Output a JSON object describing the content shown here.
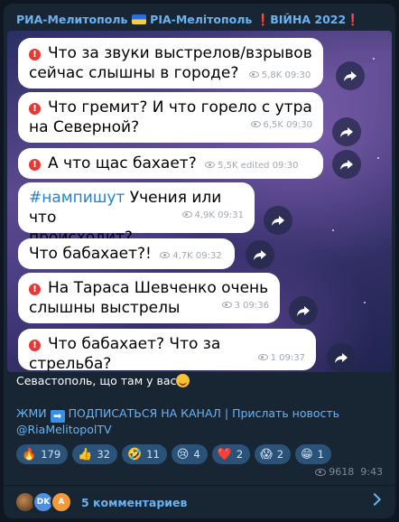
{
  "channel": {
    "name_part1": "РИА-Мелитополь",
    "name_part2": "РІА-Мелітополь",
    "war_label": "ВІЙНА 2022"
  },
  "messages": [
    {
      "line1": "Что за звуки выстрелов/взрывов",
      "line2": "сейчас слышны в городе?",
      "views": "5,8K",
      "time": "09:30",
      "alert": true
    },
    {
      "line1": "Что гремит? И что горело с утра",
      "line2": "на Северной?",
      "views": "6,5K",
      "time": "09:30",
      "alert": true
    },
    {
      "line1": "А что щас бахает?",
      "line2": "",
      "views": "5,5K",
      "edited": "edited",
      "time": "09:30",
      "alert": true
    },
    {
      "hashtag": "#нампишут",
      "line1": "Учения или что",
      "line2": "происходит?",
      "views": "4,9K",
      "time": "09:31",
      "alert": false
    },
    {
      "line1": "Что бабахает?!",
      "line2": "",
      "views": "4,7K",
      "time": "09:32",
      "alert": false
    },
    {
      "line1": "На Тараса Шевченко очень",
      "line2": "слышны выстрелы",
      "views": "3",
      "time": "09:36",
      "alert": true
    },
    {
      "line1": "Что бабахает? Что за стрельба?",
      "line2": "",
      "views": "1",
      "time": "09:37",
      "alert": true
    }
  ],
  "caption": {
    "text": "Севастополь, що там у вас",
    "cta_prefix": "ЖМИ",
    "cta_text": "ПОДПИСАТЬСЯ НА КАНАЛ | Прислать новость",
    "handle": "@RiaMelitopolTV"
  },
  "reactions": [
    {
      "emoji": "🔥",
      "count": "179"
    },
    {
      "emoji": "👍",
      "count": "32"
    },
    {
      "emoji": "🤣",
      "count": "11"
    },
    {
      "emoji": "😢",
      "count": "4"
    },
    {
      "emoji": "❤️",
      "count": "2"
    },
    {
      "emoji": "😱",
      "count": "2"
    },
    {
      "emoji": "😁",
      "count": "1"
    }
  ],
  "post": {
    "views": "9618",
    "time": "9:43"
  },
  "comments": {
    "label": "5 комментариев",
    "avatars": [
      {
        "initials": ""
      },
      {
        "initials": "DK"
      },
      {
        "initials": "A"
      }
    ]
  },
  "colors": {
    "accent": "#6ab3f3",
    "background": "#182533",
    "alert": "#e53935",
    "reaction_bg": "#2b5278"
  },
  "icons": [
    "share-icon",
    "eye-icon",
    "chevron-right-icon",
    "exclamation-icon",
    "ukraine-flag-icon",
    "arrow-right-icon"
  ]
}
